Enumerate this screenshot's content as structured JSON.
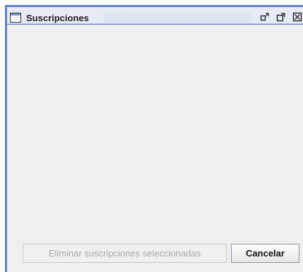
{
  "window": {
    "title": "Suscripciones",
    "controls": {
      "restore_icon": "restore-icon",
      "maximize_icon": "maximize-icon",
      "close_icon": "close-icon"
    }
  },
  "actions": {
    "delete_selected": "Eliminar suscripciones seleccionadas",
    "cancel": "Cancelar"
  }
}
